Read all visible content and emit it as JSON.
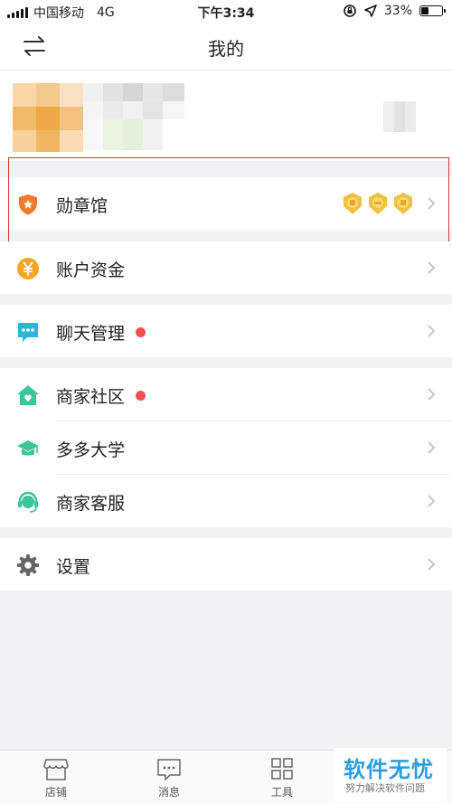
{
  "status_bar": {
    "carrier": "中国移动",
    "network": "4G",
    "time": "下午3:34",
    "battery": "33%"
  },
  "nav": {
    "title": "我的",
    "swap_icon": "swap-arrows-icon"
  },
  "menu_groups": [
    [
      {
        "id": "medals",
        "label": "勋章馆",
        "icon": "shield-star-icon",
        "color": "#f07a30",
        "badges": [
          "medal-icon",
          "medal-icon",
          "medal-icon"
        ]
      }
    ],
    [
      {
        "id": "account",
        "label": "账户资金",
        "icon": "yen-coin-icon",
        "color": "#f5a623"
      }
    ],
    [
      {
        "id": "chat",
        "label": "聊天管理",
        "icon": "chat-bubble-icon",
        "color": "#2bb5d8",
        "red_dot": true
      }
    ],
    [
      {
        "id": "community",
        "label": "商家社区",
        "icon": "house-heart-icon",
        "color": "#3cc49a",
        "red_dot": true
      },
      {
        "id": "university",
        "label": "多多大学",
        "icon": "graduation-cap-icon",
        "color": "#3cc49a"
      },
      {
        "id": "service",
        "label": "商家客服",
        "icon": "headset-icon",
        "color": "#3cc49a"
      }
    ],
    [
      {
        "id": "settings",
        "label": "设置",
        "icon": "gear-icon",
        "color": "#666666"
      }
    ]
  ],
  "tabbar": [
    {
      "label": "店铺",
      "icon": "store-icon"
    },
    {
      "label": "消息",
      "icon": "message-icon"
    },
    {
      "label": "工具",
      "icon": "grid-icon"
    }
  ],
  "watermark": {
    "main": "软件无忧",
    "sub": "努力解决软件问题"
  },
  "colors": {
    "red_dot": "#f05050",
    "highlight_border": "#e03030",
    "medal": "#f0c040"
  }
}
